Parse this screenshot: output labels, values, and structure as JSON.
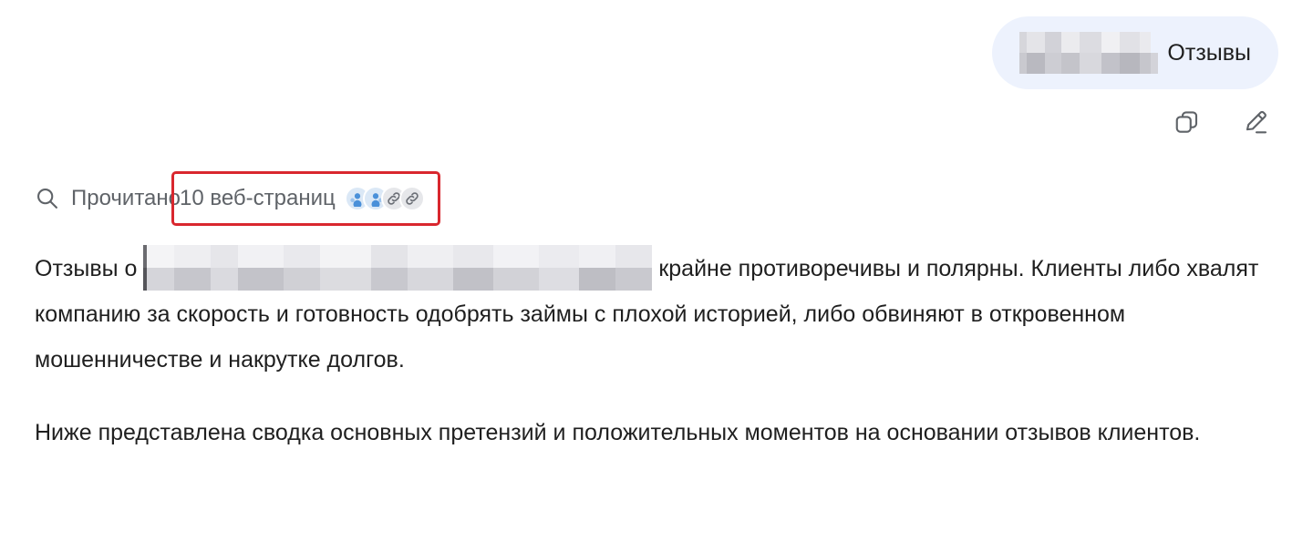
{
  "user_message": {
    "text": "Отзывы"
  },
  "message_actions": {
    "copy_icon": "copy-icon",
    "edit_icon": "edit-pencil-icon"
  },
  "sources": {
    "read_label": "Прочитано",
    "count_label": "10 веб-страниц",
    "search_icon": "search-icon",
    "favicons": [
      "blue-site-icon",
      "blue-site-icon",
      "link-icon",
      "link-icon"
    ],
    "highlight_color": "#d9272e"
  },
  "response": {
    "p1_before": "Отзывы о ",
    "p1_after": " крайне противоречивы и полярны. Клиенты либо хвалят компанию за скорость и готовность одобрять займы с плохой историей, либо обвиняют в откровенном мошенничестве и накрутке долгов.",
    "p2": "Ниже представлена сводка основных претензий и положительных моментов на основании отзывов клиентов."
  },
  "colors": {
    "bubble_bg": "#edf2fd",
    "text": "#1f1f1f",
    "muted": "#5f6368"
  }
}
